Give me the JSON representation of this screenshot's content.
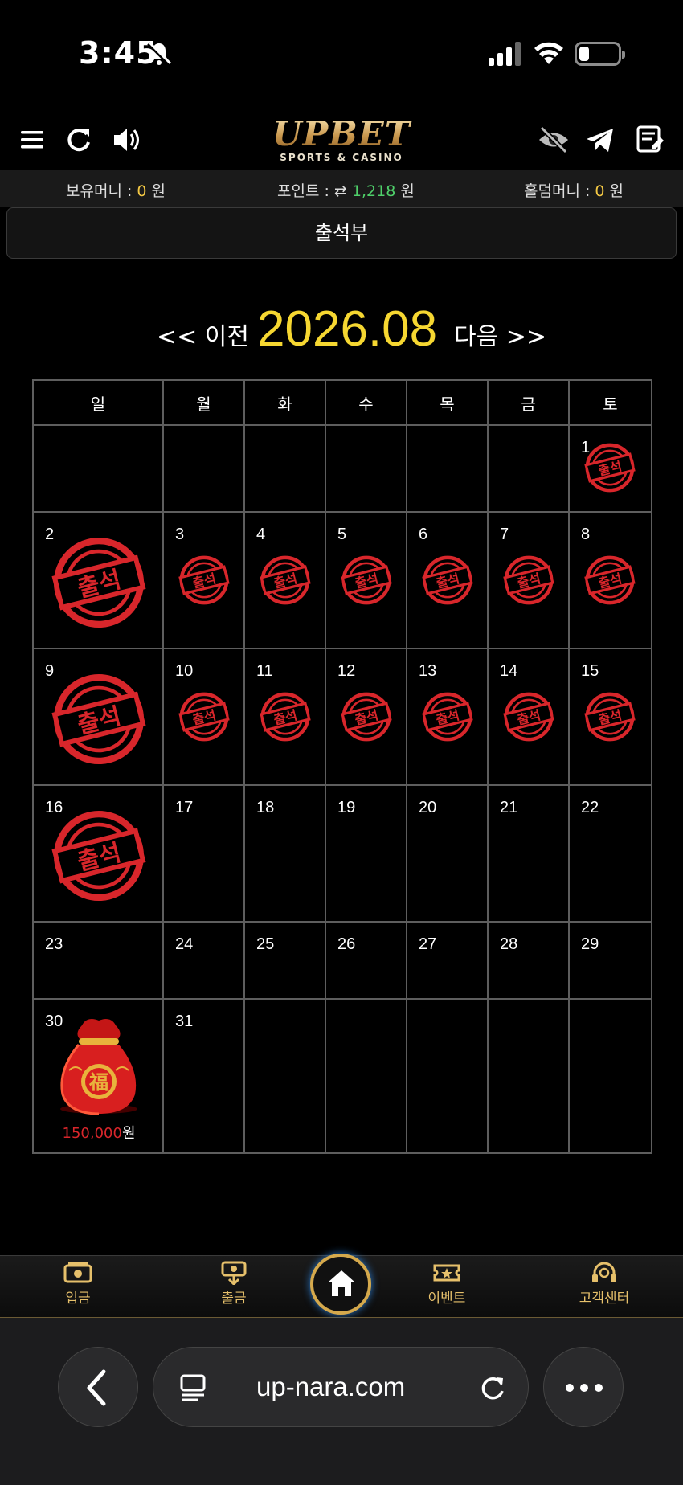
{
  "status": {
    "time": "3:45"
  },
  "header": {
    "logo_main": "UPBET",
    "logo_sub": "SPORTS & CASINO"
  },
  "money": {
    "hold_label": "보유머니 : ",
    "hold_value": "0",
    "hold_unit": " 원",
    "point_label": "포인트 : ",
    "point_value": "1,218",
    "point_unit": " 원",
    "holdem_label": "홀덤머니 : ",
    "holdem_value": "0",
    "holdem_unit": " 원"
  },
  "page": {
    "title": "출석부"
  },
  "month_nav": {
    "prev": "<< 이전",
    "month": "2026.08",
    "next": "다음 >>"
  },
  "calendar": {
    "weekdays": [
      "일",
      "월",
      "화",
      "수",
      "목",
      "금",
      "토"
    ],
    "stamp_text": "출석",
    "attended_days": [
      1,
      2,
      3,
      4,
      5,
      6,
      7,
      8,
      9,
      10,
      11,
      12,
      13,
      14,
      15,
      16
    ],
    "reward": {
      "day": 30,
      "amount": "150,000",
      "unit": "원"
    }
  },
  "bottom_nav": {
    "deposit": "입금",
    "withdraw": "출금",
    "event": "이벤트",
    "support": "고객센터"
  },
  "browser": {
    "url": "up-nara.com"
  },
  "colors": {
    "accent_gold": "#e6c06b",
    "month_yellow": "#f6d731",
    "stamp_red": "#d8262b",
    "point_green": "#4fd06a"
  }
}
